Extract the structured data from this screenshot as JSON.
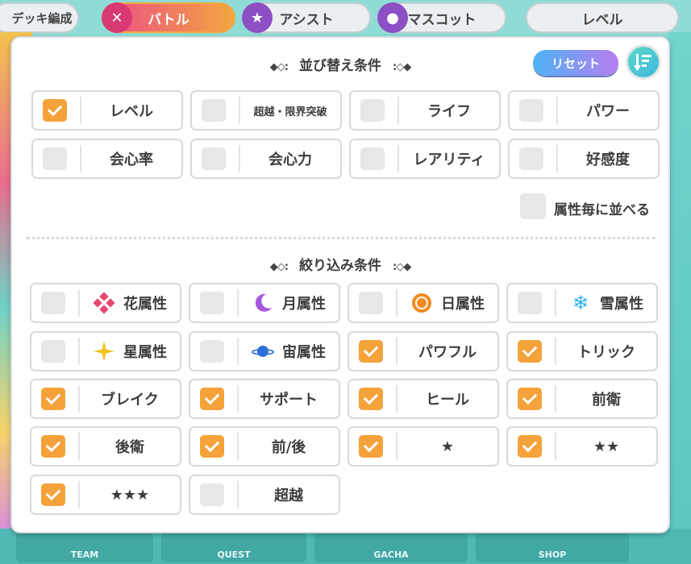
{
  "top_tabs": [
    {
      "label": "デッキ編成"
    },
    {
      "label": "バトル",
      "active": true
    },
    {
      "label": "アシスト"
    },
    {
      "label": "マスコット"
    },
    {
      "label": "レベル"
    }
  ],
  "bottom_nav": [
    {
      "label": "TEAM"
    },
    {
      "label": "QUEST"
    },
    {
      "label": "GACHA"
    },
    {
      "label": "SHOP"
    }
  ],
  "sort_section": {
    "title": "並び替え条件",
    "reset_label": "リセット",
    "options": [
      {
        "label": "レベル",
        "checked": true
      },
      {
        "label": "超越・限界突破",
        "checked": false
      },
      {
        "label": "ライフ",
        "checked": false
      },
      {
        "label": "パワー",
        "checked": false
      },
      {
        "label": "会心率",
        "checked": false
      },
      {
        "label": "会心力",
        "checked": false
      },
      {
        "label": "レアリティ",
        "checked": false
      },
      {
        "label": "好感度",
        "checked": false
      }
    ],
    "group_by_attribute_label": "属性毎に並べる",
    "group_by_attribute_checked": false
  },
  "filter_section": {
    "title": "絞り込み条件",
    "options": [
      {
        "label": "花属性",
        "checked": false,
        "icon": "flower-icon"
      },
      {
        "label": "月属性",
        "checked": false,
        "icon": "moon-icon"
      },
      {
        "label": "日属性",
        "checked": false,
        "icon": "sun-icon"
      },
      {
        "label": "雪属性",
        "checked": false,
        "icon": "snowflake-icon"
      },
      {
        "label": "星属性",
        "checked": false,
        "icon": "star-icon"
      },
      {
        "label": "宙属性",
        "checked": false,
        "icon": "planet-icon"
      },
      {
        "label": "パワフル",
        "checked": true
      },
      {
        "label": "トリック",
        "checked": true
      },
      {
        "label": "ブレイク",
        "checked": true
      },
      {
        "label": "サポート",
        "checked": true
      },
      {
        "label": "ヒール",
        "checked": true
      },
      {
        "label": "前衛",
        "checked": true
      },
      {
        "label": "後衛",
        "checked": true
      },
      {
        "label": "前/後",
        "checked": true
      },
      {
        "label": "★",
        "checked": true
      },
      {
        "label": "★★",
        "checked": true
      },
      {
        "label": "★★★",
        "checked": true
      },
      {
        "label": "超越",
        "checked": false
      }
    ]
  },
  "colors": {
    "checkbox_on": "#f5a23a",
    "checkbox_off": "#e6e7e9",
    "flower": "#e9466f",
    "moon": "#a857e0",
    "sun": "#f08a1e",
    "snow": "#2fb2e8",
    "star": "#f3c21b",
    "planet": "#2c6fd8"
  }
}
